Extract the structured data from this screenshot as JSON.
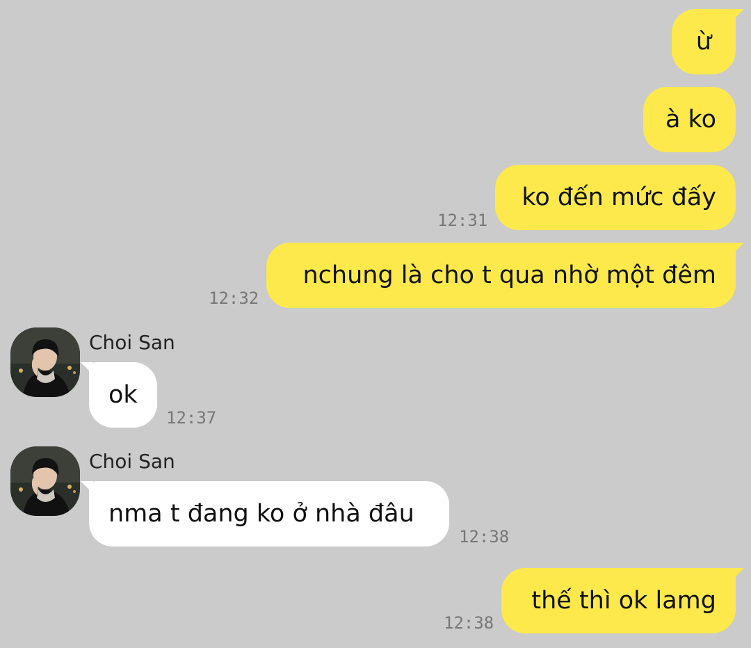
{
  "messages": [
    {
      "from": "me",
      "text": "ừ",
      "time": ""
    },
    {
      "from": "me",
      "text": "à ko",
      "time": ""
    },
    {
      "from": "me",
      "text": "ko đến mức đấy",
      "time": "12:31"
    },
    {
      "from": "me",
      "text": "nchung là cho t qua nhờ một đêm",
      "time": "12:32"
    },
    {
      "from": "them",
      "sender": "Choi San",
      "text": "ok",
      "time": "12:37",
      "avatar": "profile-photo"
    },
    {
      "from": "them",
      "sender": "Choi San",
      "text": "nma t đang ko ở nhà đâu",
      "time": "12:38",
      "avatar": "profile-photo"
    },
    {
      "from": "me",
      "text": "thế thì ok lamg",
      "time": "12:38"
    }
  ],
  "colors": {
    "background": "#cbcbcb",
    "my_bubble": "#fde94b",
    "their_bubble": "#ffffff",
    "timestamp": "#777777"
  }
}
